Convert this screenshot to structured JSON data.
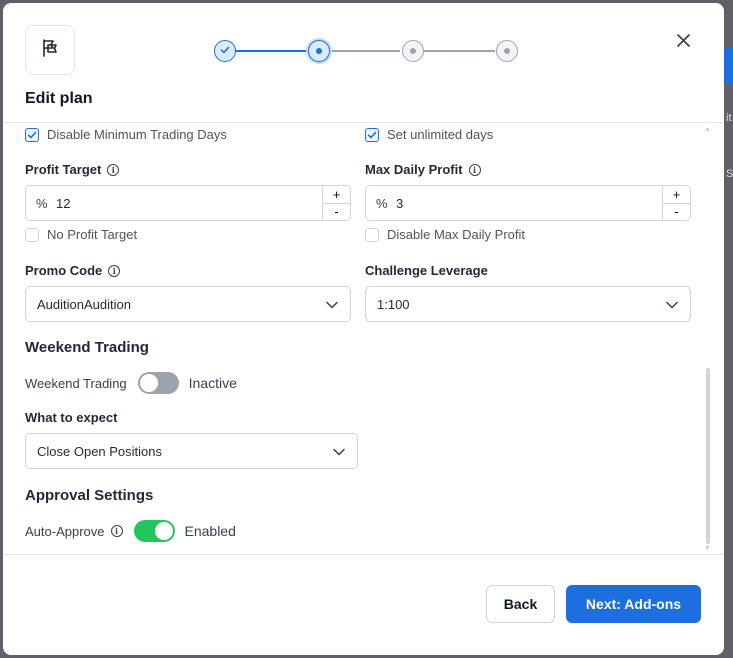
{
  "modal": {
    "title": "Edit plan",
    "stepper": {
      "steps": [
        "done",
        "current",
        "pending",
        "pending"
      ]
    }
  },
  "checkboxes": {
    "disable_min_trading_days": {
      "label": "Disable Minimum Trading Days",
      "checked": true
    },
    "set_unlimited_days": {
      "label": "Set unlimited days",
      "checked": true
    },
    "no_profit_target": {
      "label": "No Profit Target",
      "checked": false
    },
    "disable_max_daily_profit": {
      "label": "Disable Max Daily Profit",
      "checked": false
    }
  },
  "profit_target": {
    "label": "Profit Target",
    "prefix": "%",
    "value": "12",
    "plus": "+",
    "minus": "-"
  },
  "max_daily_profit": {
    "label": "Max Daily Profit",
    "prefix": "%",
    "value": "3",
    "plus": "+",
    "minus": "-"
  },
  "promo_code": {
    "label": "Promo Code",
    "value": "AuditionAudition"
  },
  "challenge_leverage": {
    "label": "Challenge Leverage",
    "value": "1:100"
  },
  "weekend": {
    "section_title": "Weekend Trading",
    "toggle_label": "Weekend Trading",
    "toggle_on": false,
    "state_text": "Inactive",
    "expect_label": "What to expect",
    "expect_value": "Close Open Positions"
  },
  "approval": {
    "section_title": "Approval Settings",
    "toggle_label": "Auto-Approve",
    "toggle_on": true,
    "state_text": "Enabled"
  },
  "footer": {
    "back_label": "Back",
    "next_label": "Next: Add-ons"
  },
  "colors": {
    "primary": "#1d6fe0",
    "toggle_on": "#22c55e",
    "toggle_off": "#9ca3af"
  },
  "icons": {
    "logo": "flag-icon",
    "close": "close-icon",
    "chevron": "chevron-down-icon",
    "info": "info-icon",
    "check": "check-icon"
  }
}
